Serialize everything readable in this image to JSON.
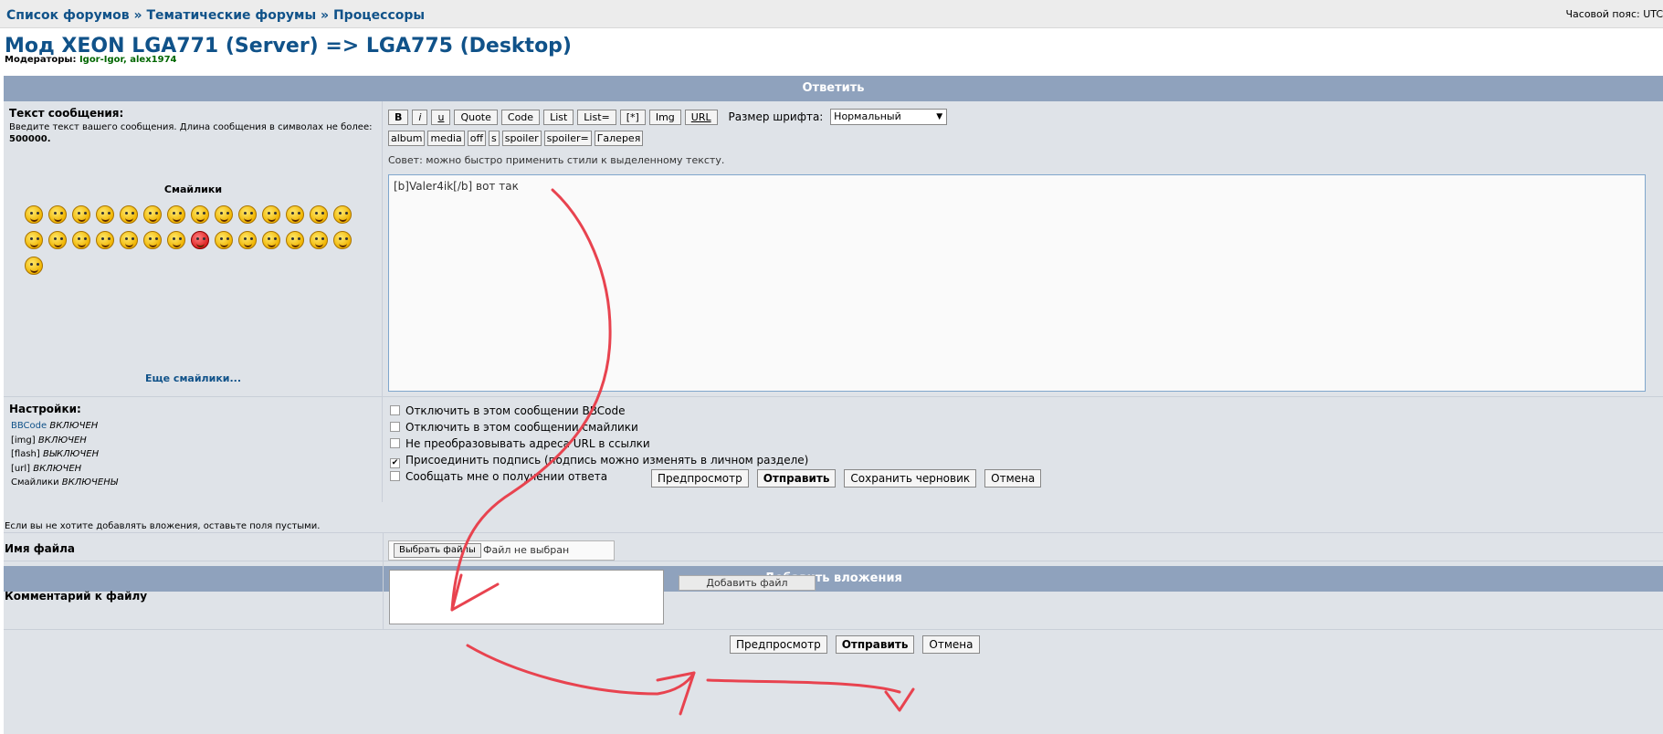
{
  "breadcrumb": {
    "items": [
      "Список форумов",
      "Тематические форумы",
      "Процессоры"
    ],
    "separator": "»"
  },
  "timezone_label": "Часовой пояс: UTC",
  "page_title": "Мод XEON LGA771 (Server) => LGA775 (Desktop)",
  "moderators": {
    "label": "Модераторы:",
    "names": "Igor-Igor, alex1974"
  },
  "reply": {
    "header": "Ответить",
    "message_label": "Текст сообщения:",
    "message_desc": "Введите текст вашего сообщения. Длина сообщения в символах не более:",
    "message_limit": "500000.",
    "smileys_title": "Смайлики",
    "more_smileys": "Еще смайлики...",
    "bbcode_row1": [
      "B",
      "i",
      "u",
      "Quote",
      "Code",
      "List",
      "List=",
      "[*]",
      "Img",
      "URL"
    ],
    "font_size_label": "Размер шрифта:",
    "font_size_value": "Нормальный",
    "bbcode_row2": [
      "album",
      "media",
      "off",
      "s",
      "spoiler",
      "spoiler=",
      "Галерея"
    ],
    "tip": "Совет: можно быстро применить стили к выделенному тексту.",
    "message_text": "[b]Valer4ik[/b] вот так"
  },
  "settings": {
    "title": "Настройки:",
    "items": [
      {
        "key": "BBCode",
        "value": "ВКЛЮЧЕН",
        "link": true
      },
      {
        "key": "[img]",
        "value": "ВКЛЮЧЕН",
        "link": false
      },
      {
        "key": "[flash]",
        "value": "ВЫКЛЮЧЕН",
        "link": false
      },
      {
        "key": "[url]",
        "value": "ВКЛЮЧЕН",
        "link": false
      },
      {
        "key": "Смайлики",
        "value": "ВКЛЮЧЕНЫ",
        "link": false
      }
    ],
    "options": [
      {
        "label": "Отключить в этом сообщении BBCode",
        "checked": false
      },
      {
        "label": "Отключить в этом сообщении смайлики",
        "checked": false
      },
      {
        "label": "Не преобразовывать адреса URL в ссылки",
        "checked": false
      },
      {
        "label": "Присоединить подпись (подпись можно изменять в личном разделе)",
        "checked": true
      },
      {
        "label": "Сообщать мне о получении ответа",
        "checked": false
      }
    ]
  },
  "actions": {
    "preview": "Предпросмотр",
    "submit": "Отправить",
    "save_draft": "Сохранить черновик",
    "cancel": "Отмена"
  },
  "attachments": {
    "header": "Добавить вложения",
    "note": "Если вы не хотите добавлять вложения, оставьте поля пустыми.",
    "file_label": "Имя файла",
    "choose_button": "Выбрать файлы",
    "file_status": "Файл не выбран",
    "comment_label": "Комментарий к файлу",
    "add_file": "Добавить файл"
  },
  "colors": {
    "link": "#105289",
    "header_bar": "#8fa2bd",
    "annotation": "#e8434f"
  }
}
